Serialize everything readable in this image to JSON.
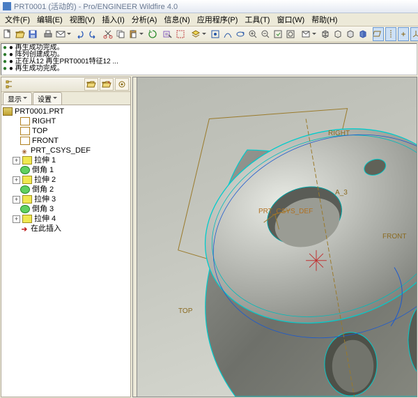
{
  "title": "PRT0001 (活动的) - Pro/ENGINEER Wildfire 4.0",
  "menu": [
    "文件(F)",
    "编辑(E)",
    "视图(V)",
    "插入(I)",
    "分析(A)",
    "信息(N)",
    "应用程序(P)",
    "工具(T)",
    "窗口(W)",
    "帮助(H)"
  ],
  "messages": [
    "● 再生成功完成。",
    "● 阵列创建成功。",
    "● 正在从12 再生PRT0001特征12 ...",
    "● 再生成功完成。"
  ],
  "tab_show": "显示",
  "tab_settings": "设置",
  "tree": {
    "root": "PRT0001.PRT",
    "planes": [
      "RIGHT",
      "TOP",
      "FRONT"
    ],
    "csys": "PRT_CSYS_DEF",
    "feats": [
      {
        "t": "ext",
        "l": "拉伸 1"
      },
      {
        "t": "rnd",
        "l": "倒角 1"
      },
      {
        "t": "ext",
        "l": "拉伸 2"
      },
      {
        "t": "rnd",
        "l": "倒角 2"
      },
      {
        "t": "ext",
        "l": "拉伸 3"
      },
      {
        "t": "rnd",
        "l": "倒角 3"
      },
      {
        "t": "ext",
        "l": "拉伸 4"
      }
    ],
    "insert": "在此插入"
  },
  "datum": {
    "top": "TOP",
    "front": "FRONT",
    "right": "RIGHT",
    "csys": "PRT_CSYS_DEF",
    "axis": "A_3"
  }
}
